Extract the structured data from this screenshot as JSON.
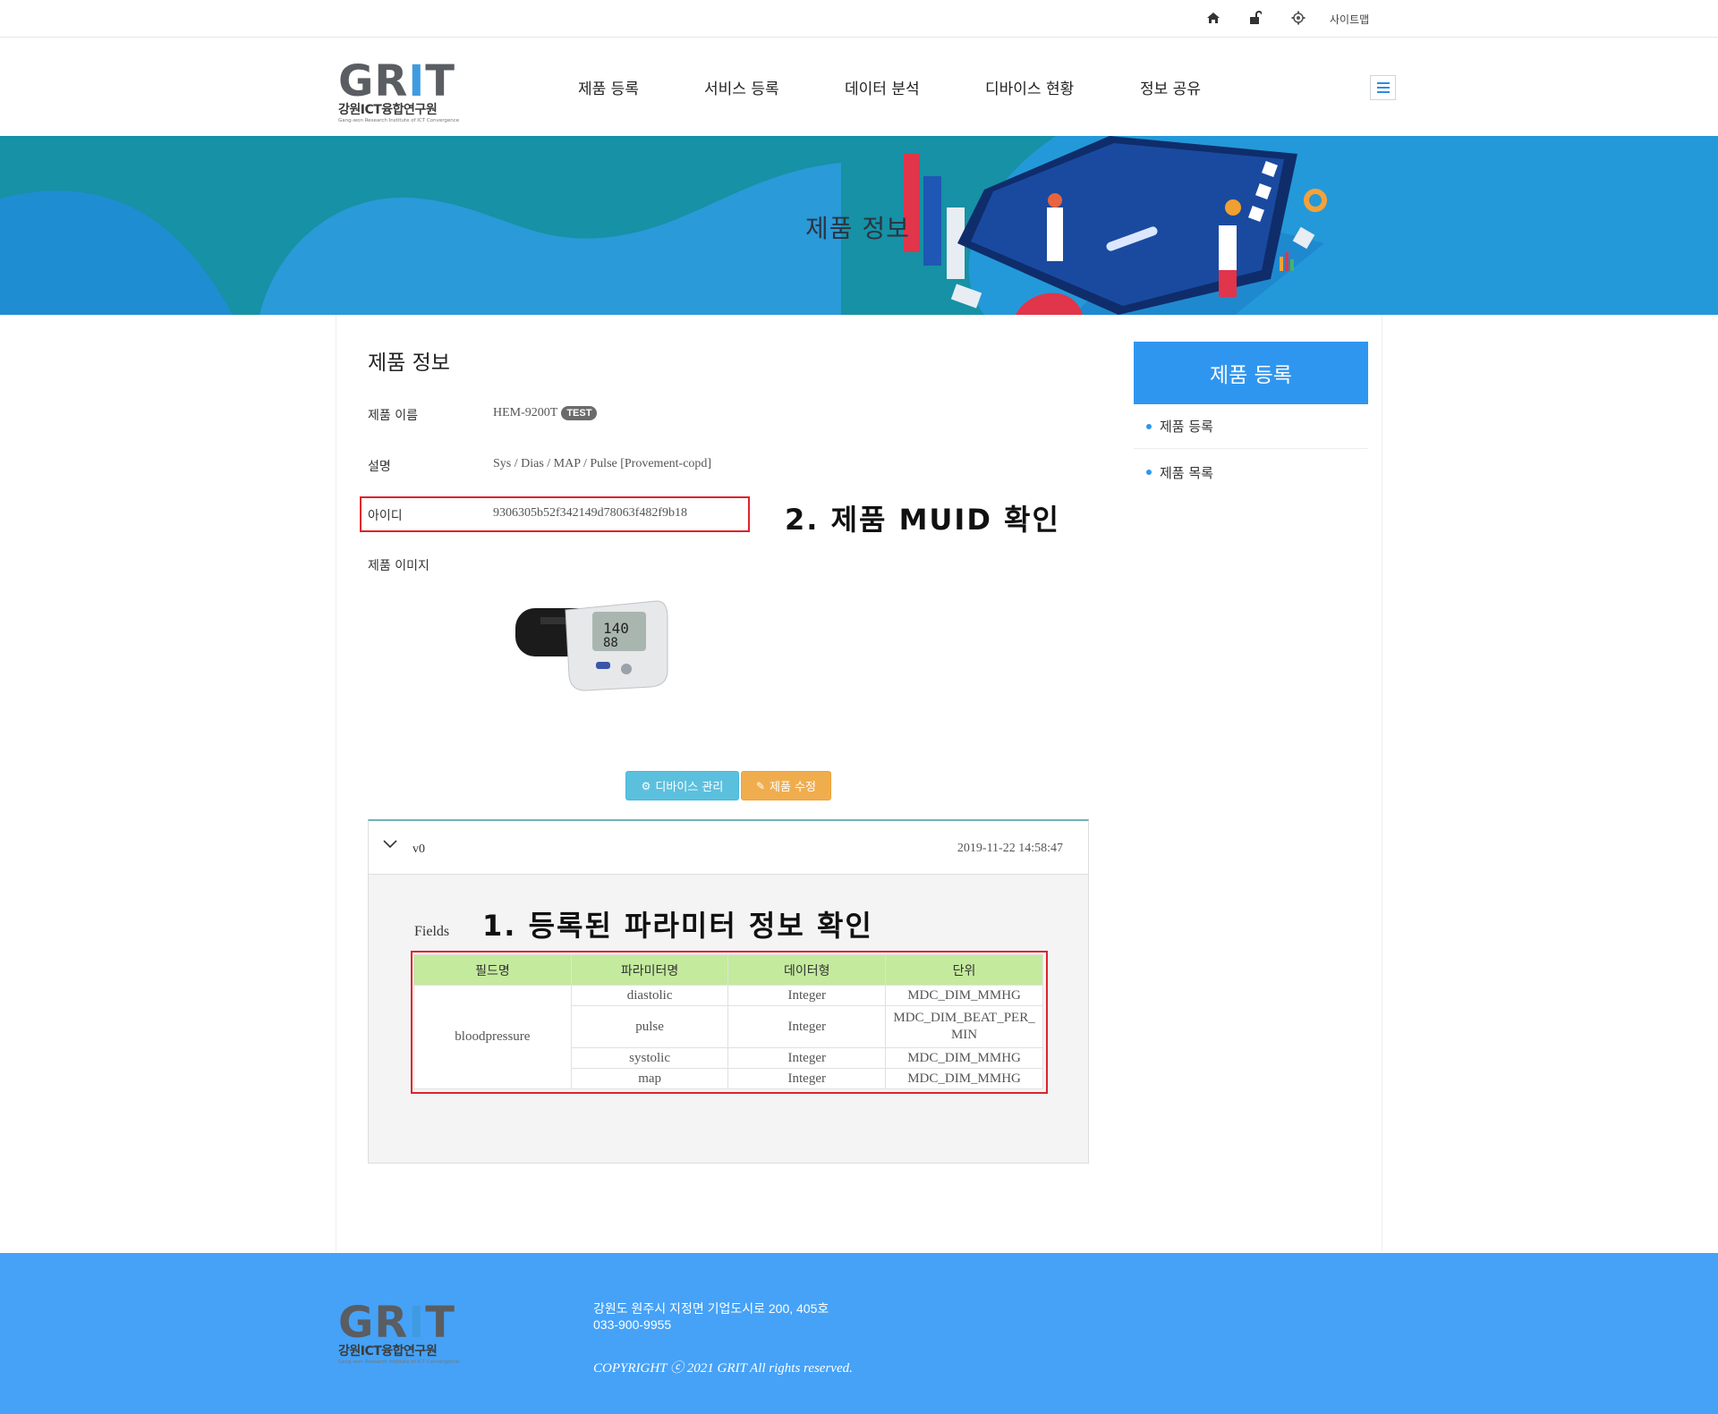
{
  "util": {
    "home_icon": "home-icon",
    "lock_icon": "unlock-icon",
    "gear_icon": "gear-icon",
    "sitemap": "사이트맵"
  },
  "brand": {
    "logo_main": "GRIT",
    "logo_kor": "강원ICT융합연구원",
    "logo_eng": "Gang-won Research Institute of ICT Convergence"
  },
  "nav": [
    {
      "label": "제품 등록"
    },
    {
      "label": "서비스 등록"
    },
    {
      "label": "데이터 분석"
    },
    {
      "label": "디바이스 현황"
    },
    {
      "label": "정보 공유"
    }
  ],
  "banner": {
    "title": "제품 정보"
  },
  "product": {
    "section_title": "제품 정보",
    "name_label": "제품 이름",
    "name_value": "HEM-9200T",
    "name_badge": "TEST",
    "desc_label": "설명",
    "desc_value": "Sys / Dias / MAP / Pulse [Provement-copd]",
    "id_label": "아이디",
    "id_value": "9306305b52f342149d78063f482f9b18",
    "image_label": "제품 이미지"
  },
  "annotations": {
    "muid": "2. 제품 MUID 확인",
    "params": "1. 등록된 파라미터 정보 확인"
  },
  "buttons": {
    "device_manage": "디바이스 관리",
    "product_edit": "제품 수정"
  },
  "version": {
    "label": "v0",
    "date": "2019-11-22 14:58:47",
    "fields_label": "Fields",
    "headers": [
      "필드명",
      "파라미터명",
      "데이터형",
      "단위"
    ],
    "field_name": "bloodpressure",
    "rows": [
      {
        "param": "diastolic",
        "type": "Integer",
        "unit": "MDC_DIM_MMHG"
      },
      {
        "param": "pulse",
        "type": "Integer",
        "unit": "MDC_DIM_BEAT_PER_MIN"
      },
      {
        "param": "systolic",
        "type": "Integer",
        "unit": "MDC_DIM_MMHG"
      },
      {
        "param": "map",
        "type": "Integer",
        "unit": "MDC_DIM_MMHG"
      }
    ]
  },
  "sidebar": {
    "title": "제품 등록",
    "items": [
      {
        "label": "제품 등록"
      },
      {
        "label": "제품 목록"
      }
    ]
  },
  "footer": {
    "address": "강원도 원주시 지정면 기업도시로 200, 405호",
    "phone": "033-900-9955",
    "copyright": "COPYRIGHT ⓒ 2021 GRIT All rights reserved."
  },
  "colors": {
    "accent": "#2f96f0",
    "footer_bg": "#45a2f7",
    "table_header": "#c3ea9d",
    "highlight_red": "#e0222b",
    "btn_info": "#5bc0de",
    "btn_warning": "#f0ad4e"
  }
}
